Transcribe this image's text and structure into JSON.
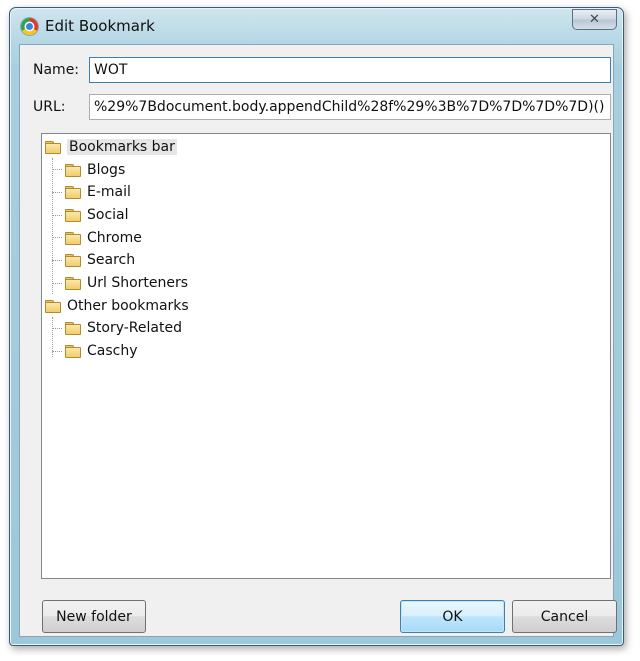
{
  "window": {
    "title": "Edit Bookmark",
    "close_glyph": "✕"
  },
  "form": {
    "name_label": "Name:",
    "name_value": "WOT",
    "url_label": "URL:",
    "url_value": "%29%7Bdocument.body.appendChild%28f%29%3B%7D%7D%7D%7D)()"
  },
  "tree": {
    "root1": {
      "label": "Bookmarks bar",
      "icon": "folder-open-icon"
    },
    "root1_children": [
      "Blogs",
      "E-mail",
      "Social",
      "Chrome",
      "Search",
      "Url Shorteners"
    ],
    "root2": {
      "label": "Other bookmarks",
      "icon": "folder-icon"
    },
    "root2_children": [
      "Story-Related",
      "Caschy"
    ]
  },
  "buttons": {
    "new_folder": "New folder",
    "ok": "OK",
    "cancel": "Cancel"
  },
  "colors": {
    "accent": "#3c7fb1",
    "frame": "#a9cfdf",
    "folder": "#f0cd6e"
  }
}
